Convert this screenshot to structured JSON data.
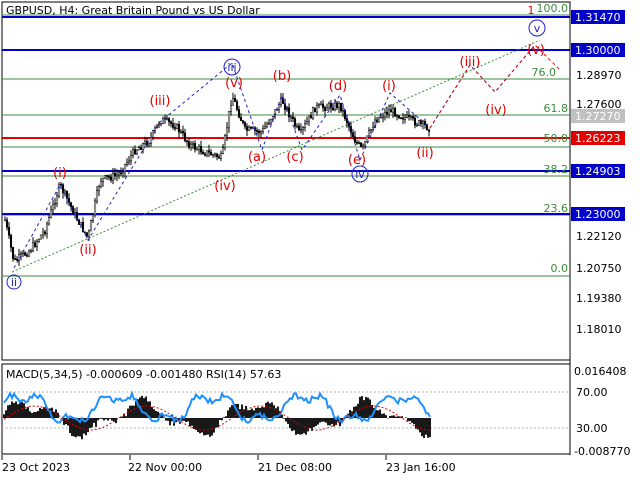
{
  "header": {
    "symbol": "GBPUSD",
    "timeframe": "H4",
    "description": "Great Britain Pound vs US Dollar",
    "full": "GBPUSD, H4:  Great Britain Pound vs US Dollar"
  },
  "price_axis": {
    "ticks": [
      "1.31470",
      "1.28970",
      "1.27600",
      "1.22120",
      "1.20750",
      "1.19380",
      "1.18010"
    ],
    "badges": [
      {
        "label": "1.31470",
        "color": "#0000c8"
      },
      {
        "label": "1.30000",
        "color": "#0000c8"
      },
      {
        "label": "1.27270",
        "color": "#c0c0c0"
      },
      {
        "label": "1.26223",
        "color": "#e00000"
      },
      {
        "label": "1.24903",
        "color": "#0000c8"
      },
      {
        "label": "1.23000",
        "color": "#0000c8"
      }
    ]
  },
  "fib_levels": [
    "100.0",
    "76.0",
    "61.8",
    "50.0",
    "38.2",
    "23.6",
    "0.0"
  ],
  "wave_labels": {
    "blue": [
      "ii",
      "iii",
      "iv",
      "v"
    ],
    "red": [
      "(i)",
      "(ii)",
      "(iii)",
      "(iv)",
      "(v)",
      "(i)",
      "(ii)",
      "(iii)",
      "(iv)",
      "(v)",
      "(a)",
      "(b)",
      "(c)",
      "(d)",
      "(e)",
      "(ii)"
    ],
    "corner_marker": "1"
  },
  "indicator": {
    "title": "MACD(5,34,5) -0.000609 -0.001480 RSI(14) 57.63",
    "ticks": [
      "0.016408",
      "70.00",
      "30.00",
      "-0.008770"
    ]
  },
  "time_axis": [
    "23 Oct 2023",
    "22 Nov 00:00",
    "21 Dec 08:00",
    "23 Jan 16:00"
  ],
  "colors": {
    "blue_line": "#0000c8",
    "red_line": "#e00000",
    "fib": "#3c8c3c",
    "wave_red": "#e00000",
    "wave_blue": "#2020c0",
    "rsi": "#1e90ff",
    "macd": "#000000"
  },
  "chart_data": {
    "type": "candlestick",
    "symbol": "GBPUSD",
    "timeframe": "H4",
    "x_range": [
      "2023-10-23",
      "2024-02-01"
    ],
    "y_range": [
      1.175,
      1.318
    ],
    "horizontal_levels": [
      1.3147,
      1.3,
      1.2727,
      1.26223,
      1.24903,
      1.23
    ],
    "fibonacci": {
      "0.0": 1.207,
      "23.6": 1.2325,
      "38.2": 1.2487,
      "50.0": 1.2621,
      "61.8": 1.2755,
      "76.0": 1.291,
      "100.0": 1.3147
    },
    "indicators": [
      {
        "name": "MACD(5,34,5)",
        "main": -0.000609,
        "signal": -0.00148
      },
      {
        "name": "RSI(14)",
        "value": 57.63,
        "levels": [
          70,
          30
        ]
      }
    ]
  }
}
